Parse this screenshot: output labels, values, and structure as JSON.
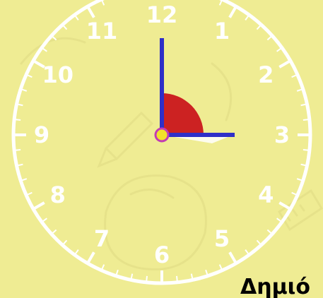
{
  "clock": {
    "numerals": [
      "12",
      "1",
      "2",
      "3",
      "4",
      "5",
      "6",
      "7",
      "8",
      "9",
      "10",
      "11"
    ],
    "time": {
      "hour": 3,
      "minute": 0
    },
    "angle_marker": "right-angle-arc"
  },
  "caption": {
    "text": "Δημιό"
  },
  "colors": {
    "background": "#efec93",
    "clock_face_stroke": "#ffffff",
    "hands": "#2f2fc8",
    "angle_arc": "#cc2222",
    "center_dot_fill": "#f2e22a",
    "center_dot_stroke": "#c23bb5"
  },
  "icons": [
    "pencil-doodle-icon",
    "backpack-doodle-icon",
    "ruler-doodle-icon"
  ]
}
